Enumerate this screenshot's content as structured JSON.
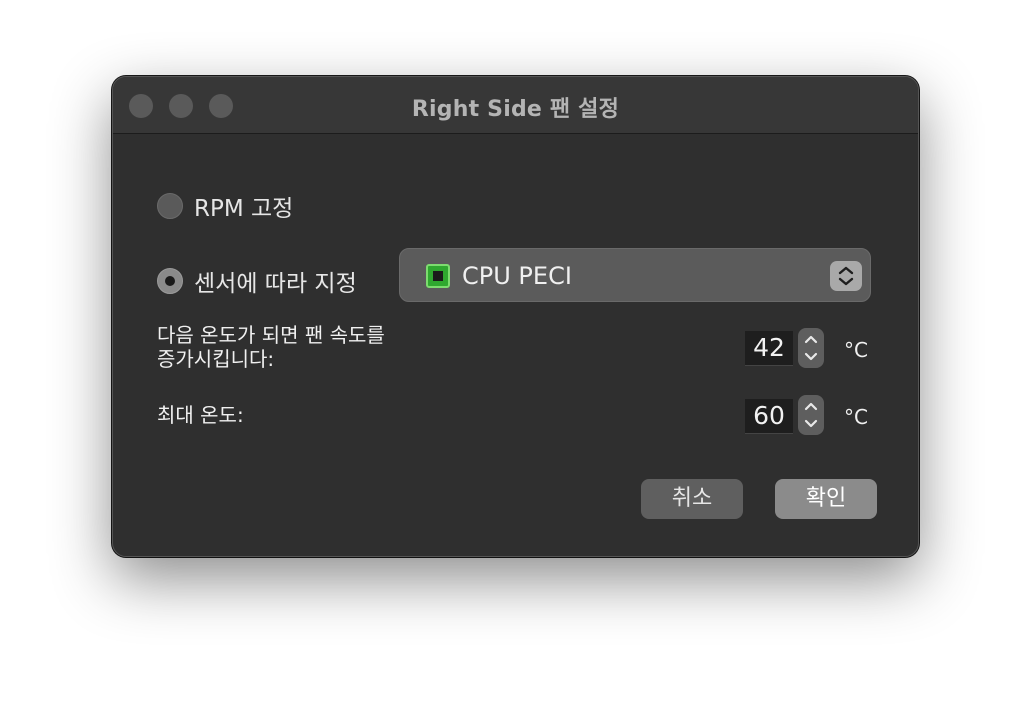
{
  "window": {
    "title": "Right Side 팬 설정"
  },
  "mode": {
    "fixed_rpm_label": "RPM 고정",
    "sensor_label": "센서에 따라 지정",
    "selected": "sensor"
  },
  "sensor_select": {
    "value": "CPU PECI",
    "icon": "cpu-chip-icon"
  },
  "min_temp": {
    "label": "다음 온도가 되면 팬 속도를 증가시킵니다:",
    "label_line1": "다음 온도가 되면 팬 속도를",
    "label_line2": "증가시킵니다:",
    "value": "42",
    "unit": "°C"
  },
  "max_temp": {
    "label": "최대 온도:",
    "value": "60",
    "unit": "°C"
  },
  "buttons": {
    "cancel": "취소",
    "ok": "확인"
  }
}
